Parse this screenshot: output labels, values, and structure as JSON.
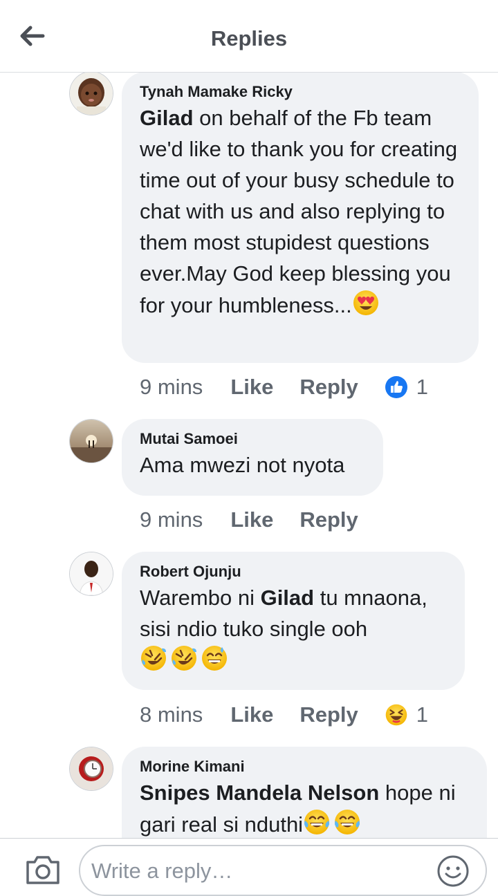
{
  "header": {
    "title": "Replies",
    "back_icon": "arrow-left-icon"
  },
  "comments": [
    {
      "author": "Tynah Mamake Ricky",
      "mention": "Gilad",
      "text": " on behalf of the Fb team we'd like to thank you for creating time out of your busy schedule to chat with us and also replying to them most stupidest questions ever.May God keep blessing you for your humbleness...",
      "emojis": [
        "heart-eyes-emoji"
      ],
      "time": "9 mins",
      "like_label": "Like",
      "reply_label": "Reply",
      "reaction": {
        "icon": "like-reaction-icon",
        "count": "1"
      }
    },
    {
      "author": "Mutai Samoei",
      "text": "Ama mwezi not nyota",
      "time": "9 mins",
      "like_label": "Like",
      "reply_label": "Reply"
    },
    {
      "author": "Robert Ojunju",
      "text_before": "Warembo ni ",
      "mention": "Gilad",
      "text_after": " tu mnaona, sisi ndio tuko single ooh",
      "emojis": [
        "rofl-emoji",
        "rofl-emoji",
        "sweat-smile-emoji"
      ],
      "time": "8 mins",
      "like_label": "Like",
      "reply_label": "Reply",
      "reaction": {
        "icon": "haha-reaction-icon",
        "count": "1"
      }
    },
    {
      "author": "Morine Kimani",
      "mention": "Snipes Mandela Nelson",
      "text": " hope ni gari real si nduthi",
      "emojis": [
        "tears-of-joy-emoji",
        "tears-of-joy-emoji"
      ]
    }
  ],
  "footer": {
    "camera_icon": "camera-icon",
    "reply_placeholder": "Write a reply…",
    "emoji_icon": "smiley-icon"
  },
  "colors": {
    "bubble": "#f0f2f5",
    "like_blue": "#1877f2",
    "muted": "#606770",
    "title": "#4b4f56"
  }
}
